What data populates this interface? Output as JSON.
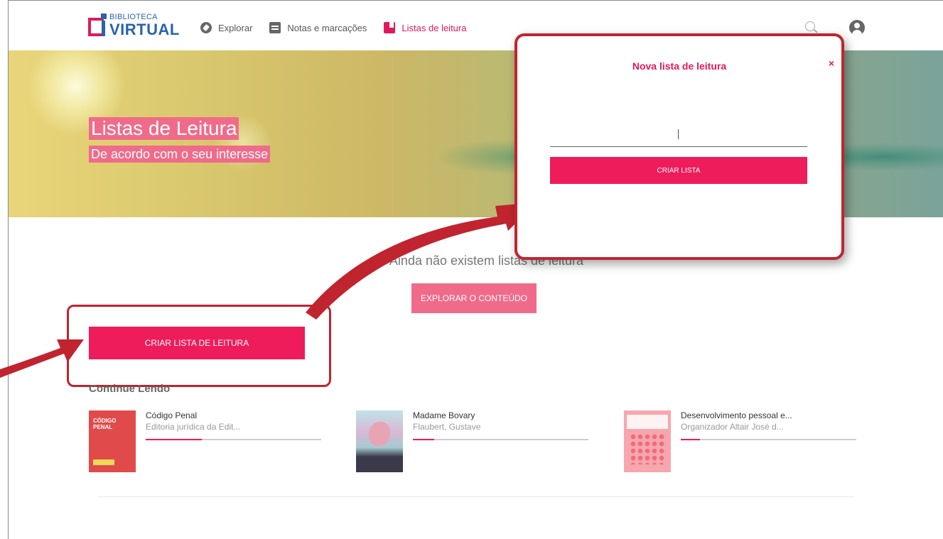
{
  "logo": {
    "line1": "BIBLIOTECA",
    "line2": "VIRTUAL"
  },
  "nav": {
    "explore": "Explorar",
    "notes": "Notas e marcações",
    "lists": "Listas de leitura"
  },
  "hero": {
    "title": "Listas de Leitura",
    "subtitle": "De acordo com o seu interesse"
  },
  "empty": {
    "message": "Ainda não existem listas de leitura",
    "explore_button": "EXPLORAR O CONTEÚDO",
    "create_button": "CRIAR LISTA DE LEITURA"
  },
  "continue_reading": {
    "title": "Continue Lendo",
    "books": [
      {
        "title": "Código Penal",
        "subtitle": "Editoria jurídica da Edit...",
        "progress": 0.32,
        "cover_text": "CÓDIGO PENAL"
      },
      {
        "title": "Madame Bovary",
        "subtitle": "Flaubert, Gustave",
        "progress": 0.12
      },
      {
        "title": "Desenvolvimento pessoal e...",
        "subtitle": "Organizador Altair José d...",
        "progress": 0.11
      }
    ]
  },
  "modal": {
    "title": "Nova lista de leitura",
    "close": "×",
    "input_value": "",
    "submit": "CRIAR LISTA"
  },
  "colors": {
    "accent": "#ee1c5b",
    "accent_soft": "#f06b8a",
    "brand_blue": "#2a63a8",
    "callout": "#c0242f"
  }
}
